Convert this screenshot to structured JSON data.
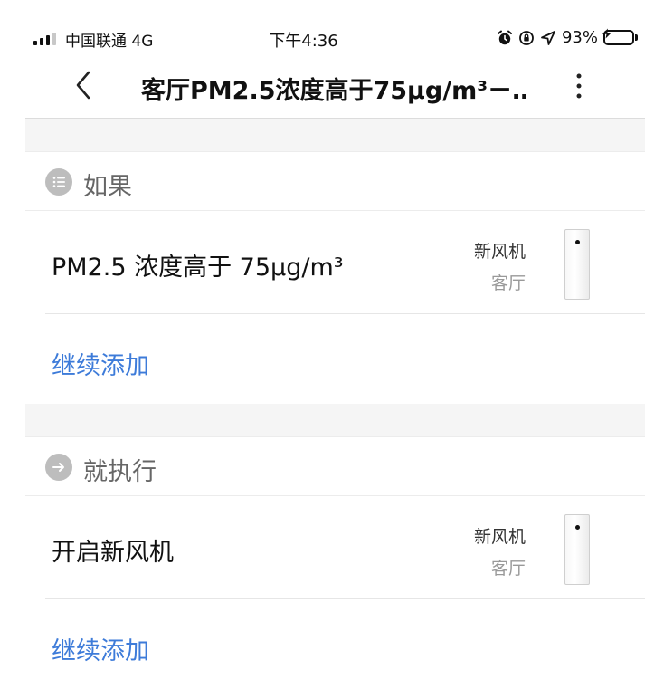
{
  "status_bar": {
    "carrier": "中国联通 4G",
    "time": "下午4:36",
    "battery": "93%",
    "icons": [
      "alarm-icon",
      "orientation-lock-icon",
      "location-icon",
      "battery-charging-icon"
    ]
  },
  "nav": {
    "title": "客厅PM2.5浓度高于75μg/m³－…",
    "icons": [
      "back-chevron-icon",
      "more-vertical-icon"
    ]
  },
  "if_section": {
    "label": "如果",
    "icon": "list-icon",
    "items": [
      {
        "text": "PM2.5 浓度高于 75μg/m³",
        "device": "新风机",
        "room": "客厅"
      }
    ],
    "add_label": "继续添加"
  },
  "then_section": {
    "label": "就执行",
    "icon": "arrow-right-icon",
    "items": [
      {
        "text": "开启新风机",
        "device": "新风机",
        "room": "客厅"
      }
    ],
    "add_label": "继续添加"
  },
  "colors": {
    "accent": "#3d7bd9",
    "section_band": "#f5f5f5",
    "section_icon": "#bdbdbd",
    "battery": "#34c759"
  }
}
